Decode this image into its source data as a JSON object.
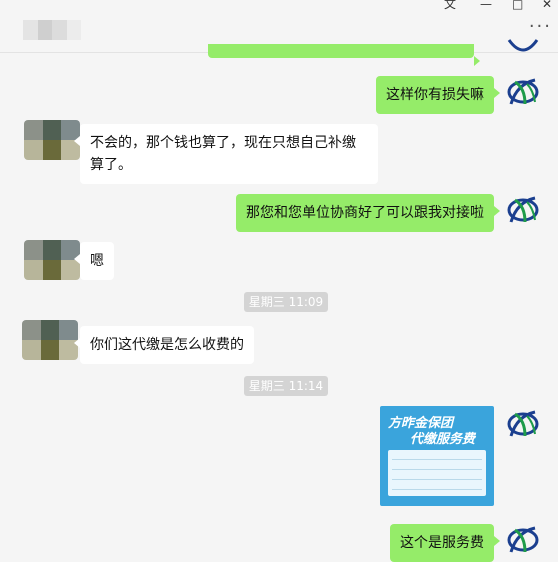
{
  "window": {
    "controls": [
      "⽂",
      "—",
      "□",
      "✕"
    ],
    "more_label": "···"
  },
  "messages": [
    {
      "side": "me",
      "text": "这样你有损失嘛"
    },
    {
      "side": "them",
      "text": "不会的，那个钱也算了，现在只想自己补缴算了。"
    },
    {
      "side": "me",
      "text": "那您和您单位协商好了可以跟我对接啦"
    },
    {
      "side": "them",
      "text": "嗯"
    },
    {
      "side": "time",
      "text": "星期三 11:09"
    },
    {
      "side": "them",
      "text": "你们这代缴是怎么收费的"
    },
    {
      "side": "time",
      "text": "星期三 11:14"
    },
    {
      "side": "me",
      "type": "image",
      "caption_1": "方昨金保团",
      "caption_2": "代缴服务费"
    },
    {
      "side": "me",
      "text": "这个是服务费"
    }
  ],
  "colors": {
    "my_bubble": "#95ec69",
    "their_bubble": "#ffffff",
    "background": "#f5f5f5",
    "time_badge": "#d4d4d4",
    "image_card": "#3aa4dc"
  },
  "avatars": {
    "me_icon": "leaf-logo-icon",
    "them_icon": "pixelated-avatar"
  }
}
